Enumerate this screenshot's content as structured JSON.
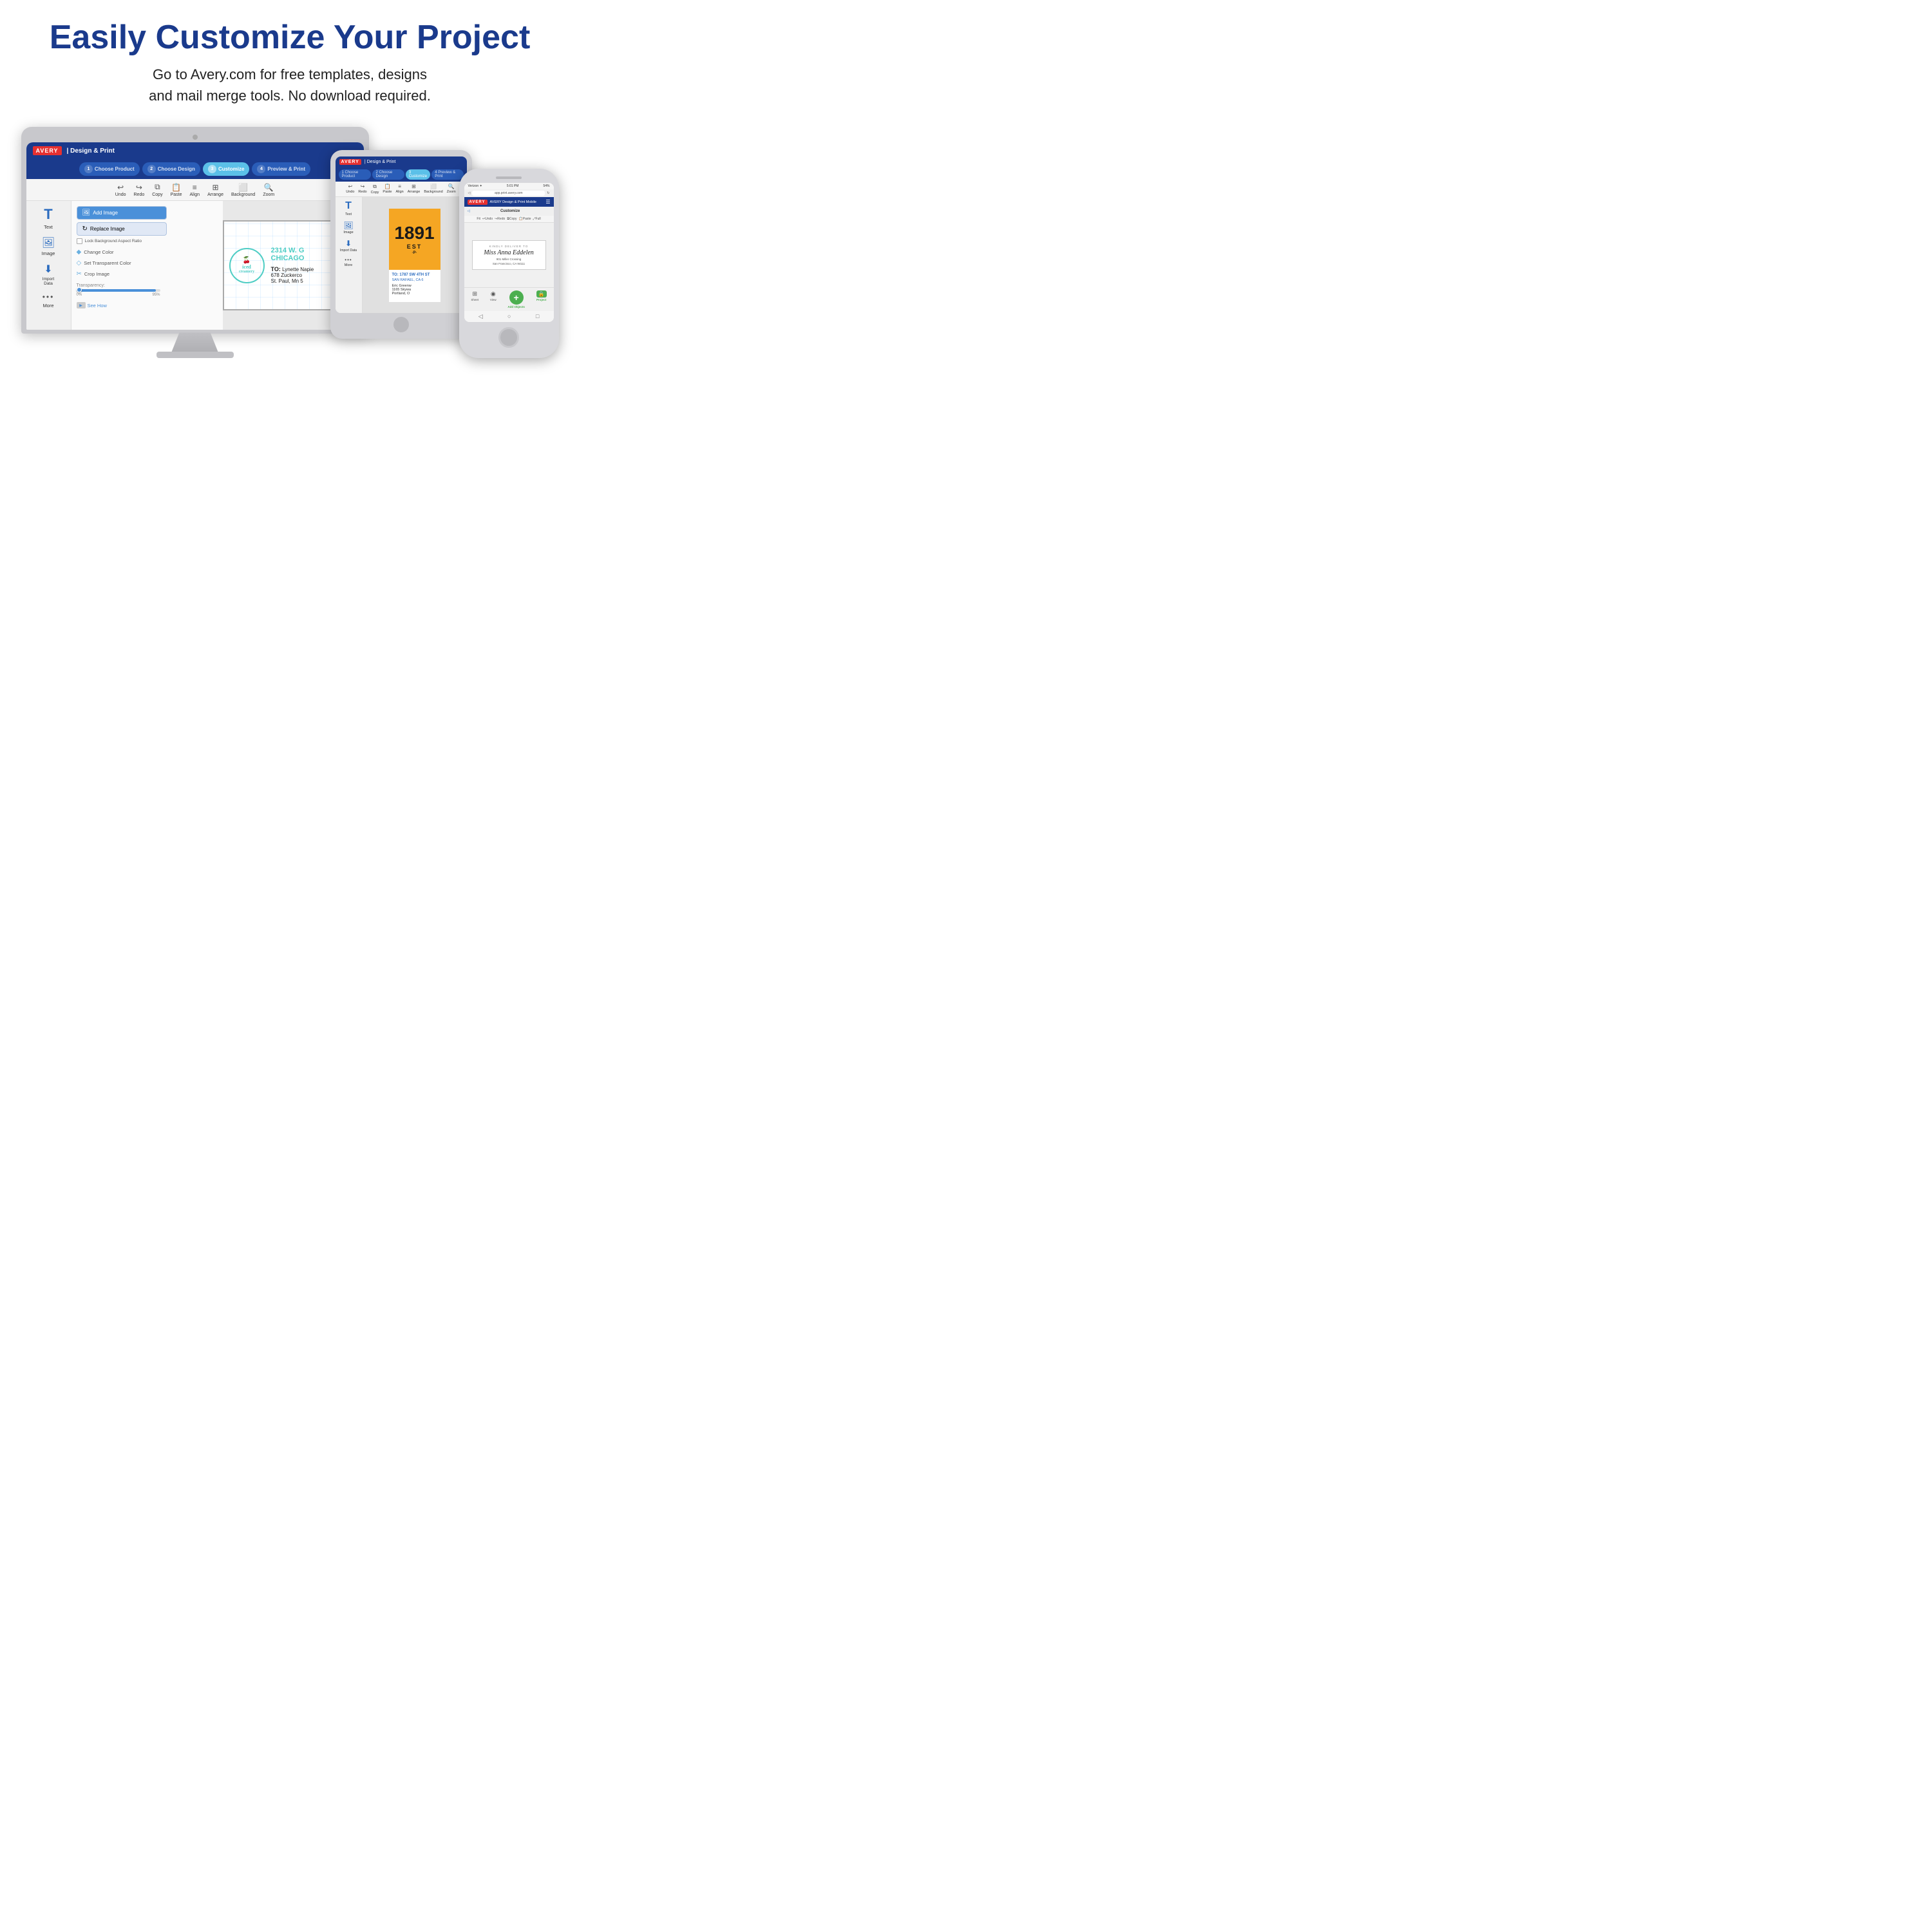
{
  "header": {
    "title": "Easily Customize Your Project",
    "subtitle_line1": "Go to Avery.com for free templates, designs",
    "subtitle_line2": "and mail merge tools. No download required."
  },
  "avery_app": {
    "logo": "AVERY",
    "brand": "| Design & Print",
    "steps": [
      {
        "num": "1",
        "label": "Choose Product",
        "active": false
      },
      {
        "num": "2",
        "label": "Choose Design",
        "active": false
      },
      {
        "num": "3",
        "label": "Customize",
        "active": true
      },
      {
        "num": "4",
        "label": "Preview & Print",
        "active": false
      }
    ],
    "toolbar": {
      "items": [
        "Undo",
        "Redo",
        "Copy",
        "Paste",
        "Align",
        "Arrange",
        "Background",
        "Zoom"
      ]
    },
    "sidebar": {
      "items": [
        {
          "label": "Text",
          "icon": "T"
        },
        {
          "label": "Image",
          "icon": "🖼"
        },
        {
          "label": "Import Data",
          "icon": "⬇"
        },
        {
          "label": "More",
          "icon": "•••"
        }
      ]
    },
    "right_panel": {
      "add_image_label": "Add Image",
      "replace_image_label": "Replace Image",
      "lock_label": "Lock Background Aspect Ratio",
      "change_color_label": "Change Color",
      "set_transparent_label": "Set Transparent Color",
      "crop_label": "Crop Image",
      "transparency_label": "Transparency:",
      "pct_0": "0%",
      "pct_95": "95%",
      "see_how_label": "See How"
    },
    "label": {
      "company": "iced creamery",
      "address_line1": "2314 W. G",
      "address_line2": "CHICAGO",
      "to_label": "TO:",
      "recipient": "Lynette Napie",
      "street": "678 Zuckerco",
      "city": "St. Paul, Mn 5"
    }
  },
  "tablet_app": {
    "label_num": "1891",
    "label_est": "EST",
    "label_sub": "·P·",
    "to_label": "TO:",
    "addr_label1": "1787 SW 4TH ST",
    "addr_label2": "SAN RAFAEL, CA 6",
    "recipient": "Eric Greenw",
    "street": "1165 Skywa",
    "city": "Portland, O"
  },
  "phone_app": {
    "status": "5:01 PM",
    "battery": "54%",
    "url": "app.print.avery.com",
    "brand": "AVERY  Design & Print Mobile",
    "customize_label": "Customize",
    "kindly": "KINDLY DELIVER TO",
    "name": "Miss Anna Eddelen",
    "address": "901 Miller Crossing",
    "city": "San Francisco, CA 94111",
    "bottom_items": [
      {
        "label": "Sheet",
        "icon": "⊞"
      },
      {
        "label": "View",
        "icon": "◉"
      },
      {
        "label": "Add Objects",
        "icon": "+",
        "green": true
      },
      {
        "label": "Project",
        "icon": "🔒",
        "green": true
      }
    ],
    "nav_icons": [
      "◁",
      "○",
      "□"
    ]
  }
}
